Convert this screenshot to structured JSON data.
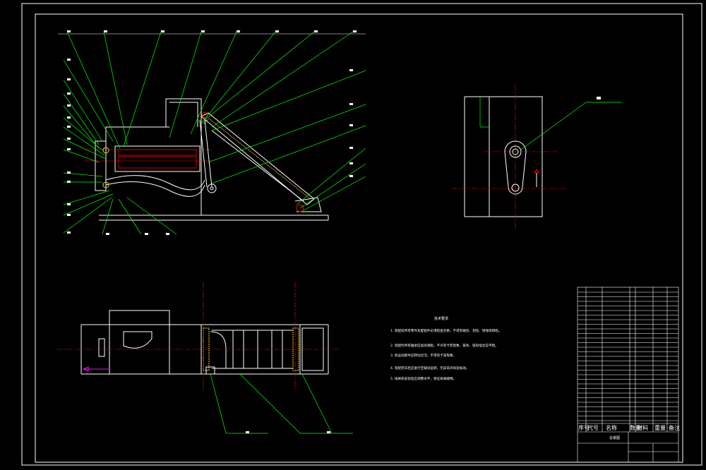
{
  "technical_requirements": {
    "title": "技术要求",
    "items": [
      "1. 装配前所有零件及配套件必须检查合格，不得有碰伤、划伤、锈蚀等缺陷。",
      "2. 装配时所有轴承应加润滑脂，不许有卡死现象，链条、链轮啮合应平稳。",
      "3. 各运动部件应转动灵活，不得有卡滞现象。",
      "4. 装配完毕后应进行空载试运转，无异常声响及振动。",
      "5. 排屑机安装后应调整水平，保证排屑顺畅。"
    ]
  },
  "title_block": {
    "header_cells": [
      "序号",
      "代号",
      "名称",
      "数量",
      "材料",
      "重量",
      "备注"
    ],
    "drawing_name": "总装图",
    "company": "",
    "drawing_number": ""
  },
  "colors": {
    "frame": "#ffffff",
    "outline": "#ffffff",
    "leader": "#00ff00",
    "center_line": "#ff0000",
    "chain": "#ffcc33",
    "accent": "#ff00ff"
  }
}
